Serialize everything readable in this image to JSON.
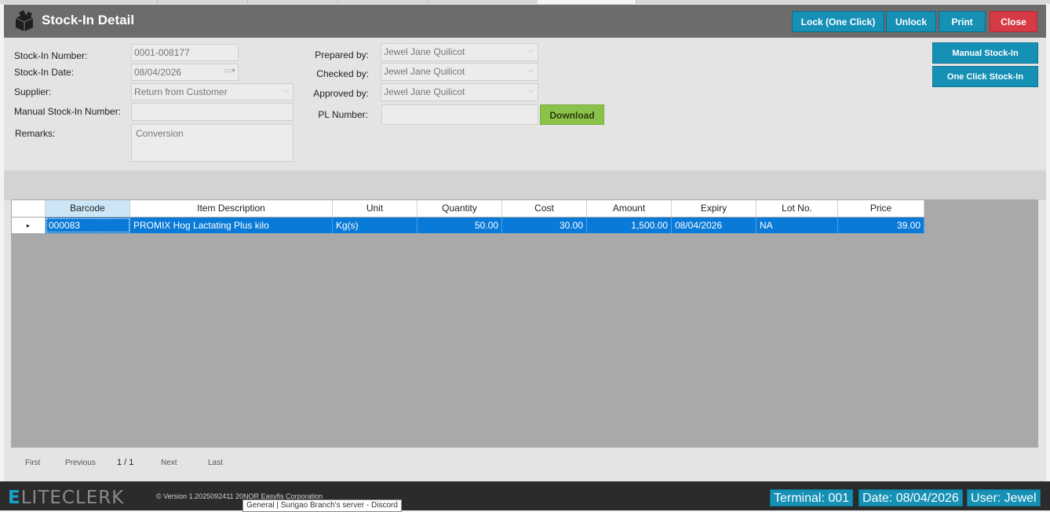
{
  "window": {
    "title": "Stock-In Detail"
  },
  "actions": {
    "lock": "Lock (One Click)",
    "unlock": "Unlock",
    "print": "Print",
    "close": "Close"
  },
  "side_actions": {
    "manual": "Manual Stock-In",
    "one_click": "One Click Stock-In"
  },
  "form": {
    "stock_in_number": {
      "label": "Stock-In Number:",
      "value": "0001-008177"
    },
    "stock_in_date": {
      "label": "Stock-In Date:",
      "value": "08/04/2026"
    },
    "supplier": {
      "label": "Supplier:",
      "value": "Return from Customer"
    },
    "manual_number": {
      "label": "Manual Stock-In Number:",
      "value": ""
    },
    "remarks": {
      "label": "Remarks:",
      "value": "Conversion"
    },
    "prepared_by": {
      "label": "Prepared by:",
      "value": "Jewel Jane Quilicot"
    },
    "checked_by": {
      "label": "Checked by:",
      "value": "Jewel Jane Quilicot"
    },
    "approved_by": {
      "label": "Approved by:",
      "value": "Jewel Jane Quilicot"
    },
    "pl_number": {
      "label": "PL Number:",
      "value": ""
    },
    "download": "Download"
  },
  "table": {
    "columns": [
      "Barcode",
      "Item Description",
      "Unit",
      "Quantity",
      "Cost",
      "Amount",
      "Expiry",
      "Lot No.",
      "Price"
    ],
    "rows": [
      [
        "000083",
        "PROMIX Hog Lactating Plus kilo",
        "Kg(s)",
        "50.00",
        "30.00",
        "1,500.00",
        "08/04/2026",
        "NA",
        "39.00"
      ]
    ],
    "row_marker": "▸"
  },
  "pager": {
    "first": "First",
    "previous": "Previous",
    "page": "1 / 1",
    "next": "Next",
    "last": "Last"
  },
  "footer": {
    "brand_prefix": "E",
    "brand_rest": "LITECLERK",
    "version": "© Version 1.2025092411 20NOR Easyfis Corporation",
    "tooltip": "General | Surigao Branch's server - Discord",
    "terminal": "Terminal: 001",
    "date": "Date: 08/04/2026",
    "user": "User: Jewel"
  },
  "colors": {
    "accent": "#1690b5",
    "close": "#d63a45",
    "download": "#8bc34a",
    "selected_row": "#0a7ad8"
  },
  "icons": {
    "logo": "box-icon",
    "dropdown": "chevron-down-icon",
    "calendar": "calendar-icon"
  }
}
